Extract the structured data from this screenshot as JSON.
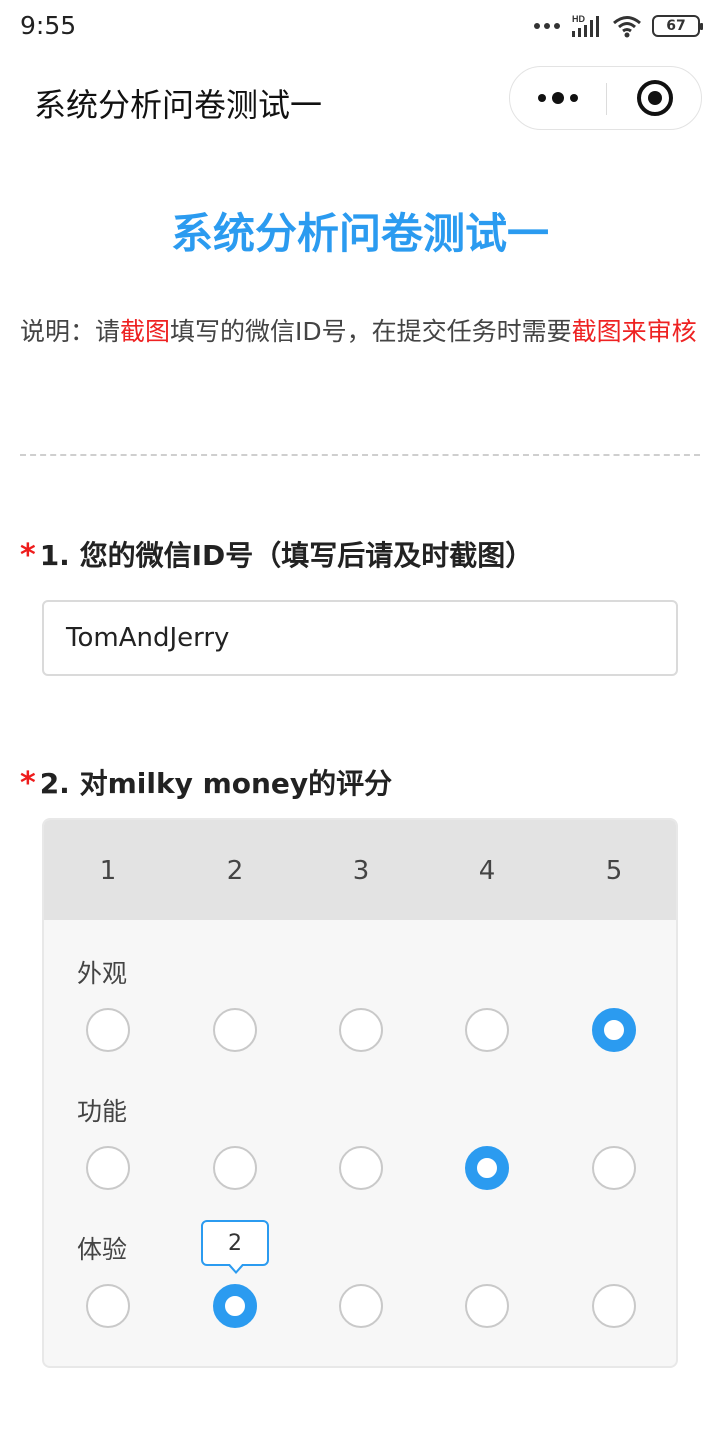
{
  "status_bar": {
    "time": "9:55",
    "network_label": "HD",
    "battery": "67",
    "icons": [
      "more-dots-icon",
      "signal-icon",
      "wifi-icon",
      "battery-icon"
    ]
  },
  "nav": {
    "title": "系统分析问卷测试一",
    "capsule_icons": [
      "more-icon",
      "close-target-icon"
    ]
  },
  "survey": {
    "title": "系统分析问卷测试一",
    "description": {
      "part1": "说明：请",
      "highlight1": "截图",
      "part2": "填写的微信ID号，在提交任务时需要",
      "highlight2": "截图来审核"
    },
    "questions": [
      {
        "required_mark": "*",
        "label": "1. 您的微信ID号（填写后请及时截图）",
        "value": "TomAndJerry"
      },
      {
        "required_mark": "*",
        "label": "2. 对milky money的评分",
        "scale": [
          "1",
          "2",
          "3",
          "4",
          "5"
        ],
        "rows": [
          {
            "label": "外观",
            "selected": "5"
          },
          {
            "label": "功能",
            "selected": "4"
          },
          {
            "label": "体验",
            "selected": "2"
          }
        ],
        "tooltip": "2"
      }
    ]
  },
  "colors": {
    "accent": "#2b9bf0",
    "required": "#ee1c1c",
    "highlight": "#ee2222"
  }
}
